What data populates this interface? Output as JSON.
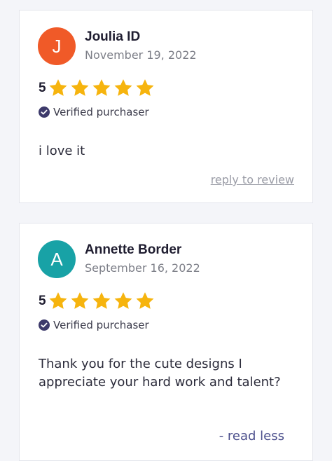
{
  "reviews": [
    {
      "avatar_letter": "J",
      "avatar_color": "#f05a28",
      "name": "Joulia ID",
      "date": "November 19, 2022",
      "rating": 5,
      "rating_label": "5",
      "verified_label": "Verified purchaser",
      "text": "i love it",
      "action_label": "reply to review"
    },
    {
      "avatar_letter": "A",
      "avatar_color": "#18a2a6",
      "name": "Annette Border",
      "date": "September 16, 2022",
      "rating": 5,
      "rating_label": "5",
      "verified_label": "Verified purchaser",
      "text": "Thank you for the cute designs I appreciate your hard work and talent?",
      "action_label": "- read less"
    }
  ],
  "colors": {
    "star": "#f6b40e",
    "verified_icon": "#3d3a6b",
    "page_bg": "#f4f5f9"
  },
  "icons": {
    "star": "star-icon",
    "verified": "check-circle-icon"
  }
}
